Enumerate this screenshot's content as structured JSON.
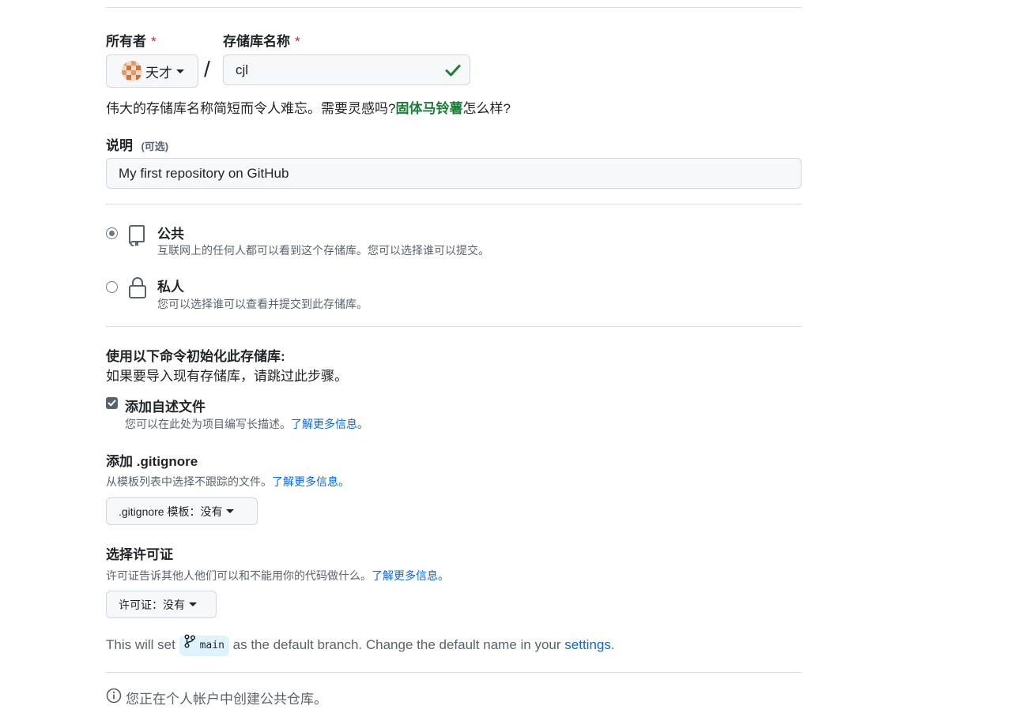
{
  "owner": {
    "label": "所有者",
    "required_mark": "*",
    "value": "天才"
  },
  "separator": "/",
  "repo": {
    "label": "存储库名称",
    "required_mark": "*",
    "value": "cjl",
    "valid_icon": "check-icon"
  },
  "suggestion": {
    "prefix": "伟大的存储库名称简短而令人难忘。需要灵感吗?",
    "name": "固体马铃薯",
    "suffix": "怎么样?"
  },
  "description": {
    "label": "说明",
    "optional": "(可选)",
    "value": "My first repository on GitHub"
  },
  "visibility": {
    "options": [
      {
        "title": "公共",
        "desc": "互联网上的任何人都可以看到这个存储库。您可以选择谁可以提交。",
        "icon": "repo-icon",
        "selected": true
      },
      {
        "title": "私人",
        "desc": "您可以选择谁可以查看并提交到此存储库。",
        "icon": "lock-icon",
        "selected": false
      }
    ]
  },
  "init": {
    "title": "使用以下命令初始化此存储库:",
    "subtitle": "如果要导入现有存储库，请跳过此步骤。",
    "readme": {
      "label": "添加自述文件",
      "desc": "您可以在此处为项目编写长描述。",
      "link": "了解更多信息。",
      "checked": true
    },
    "gitignore": {
      "title": "添加 .gitignore",
      "desc": "从模板列表中选择不跟踪的文件。",
      "link": "了解更多信息。",
      "button": ".gitignore 模板：没有"
    },
    "license": {
      "title": "选择许可证",
      "desc": "许可证告诉其他人他们可以和不能用你的代码做什么。",
      "link": "了解更多信息。",
      "button": "许可证：没有"
    }
  },
  "branch": {
    "prefix": "This will set",
    "name": "main",
    "middle": "as the default branch. Change the default name in your",
    "link": "settings",
    "suffix": "."
  },
  "notice": {
    "icon": "info-icon",
    "text": "您正在个人帐户中创建公共仓库。"
  },
  "colors": {
    "accent_link": "#0969da",
    "success": "#1a7f37",
    "required": "#cf222e"
  }
}
